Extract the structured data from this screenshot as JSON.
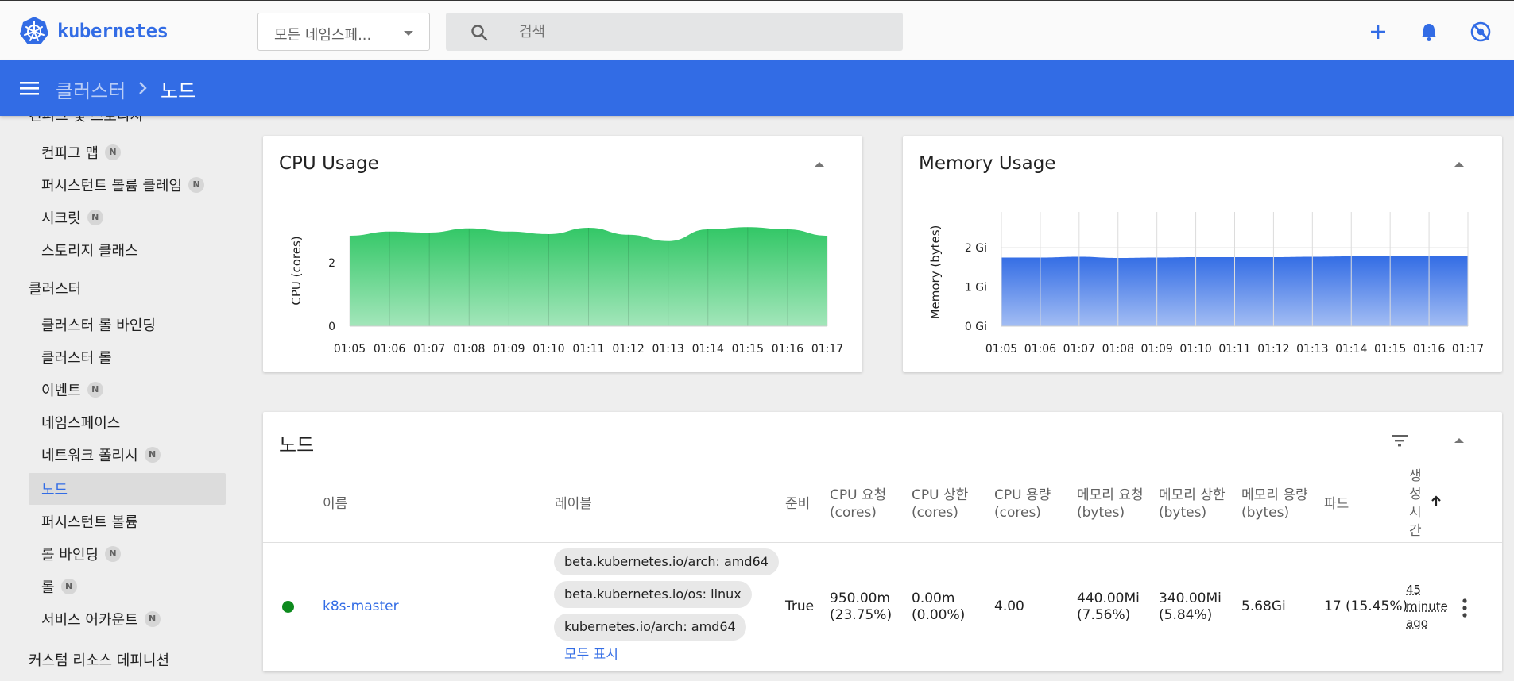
{
  "app": {
    "name": "kubernetes"
  },
  "topbar": {
    "namespace_select": "모든 네임스페...",
    "search_placeholder": "검색",
    "icons": [
      "plus-icon",
      "bell-icon",
      "settings-off-icon"
    ]
  },
  "breadcrumb": {
    "parent": "클러스터",
    "current": "노드"
  },
  "sidebar": {
    "partial_top": "컨피그 및 스토리지",
    "group1_items": [
      {
        "label": "컨피그 맵",
        "badge": "N"
      },
      {
        "label": "퍼시스턴트 볼륨 클레임",
        "badge": "N"
      },
      {
        "label": "시크릿",
        "badge": "N"
      },
      {
        "label": "스토리지 클래스",
        "badge": ""
      }
    ],
    "cluster_header": "클러스터",
    "cluster_items": [
      {
        "label": "클러스터 롤 바인딩",
        "badge": ""
      },
      {
        "label": "클러스터 롤",
        "badge": ""
      },
      {
        "label": "이벤트",
        "badge": "N"
      },
      {
        "label": "네임스페이스",
        "badge": ""
      },
      {
        "label": "네트워크 폴리시",
        "badge": "N"
      },
      {
        "label": "노드",
        "badge": "",
        "active": true
      },
      {
        "label": "퍼시스턴트 볼륨",
        "badge": ""
      },
      {
        "label": "롤 바인딩",
        "badge": "N"
      },
      {
        "label": "롤",
        "badge": "N"
      },
      {
        "label": "서비스 어카운트",
        "badge": "N"
      }
    ],
    "crd_header": "커스텀 리소스 데피니션"
  },
  "chart_data": [
    {
      "type": "area",
      "title": "CPU Usage",
      "ylabel": "CPU (cores)",
      "x": [
        "01:05",
        "01:06",
        "01:07",
        "01:08",
        "01:09",
        "01:10",
        "01:11",
        "01:12",
        "01:13",
        "01:14",
        "01:15",
        "01:16",
        "01:17"
      ],
      "y": [
        2.85,
        2.98,
        2.95,
        3.08,
        2.98,
        2.9,
        3.1,
        2.88,
        2.68,
        3.05,
        3.12,
        3.05,
        2.85
      ],
      "yticks": [
        0,
        2
      ],
      "ylim": [
        0,
        3.5
      ],
      "color": "#32c766",
      "grid": "vertical"
    },
    {
      "type": "area",
      "title": "Memory Usage",
      "ylabel": "Memory (bytes)",
      "x": [
        "01:05",
        "01:06",
        "01:07",
        "01:08",
        "01:09",
        "01:10",
        "01:11",
        "01:12",
        "01:13",
        "01:14",
        "01:15",
        "01:16",
        "01:17"
      ],
      "y": [
        1.75,
        1.75,
        1.77,
        1.74,
        1.75,
        1.76,
        1.76,
        1.76,
        1.77,
        1.78,
        1.8,
        1.79,
        1.78
      ],
      "yticks": [
        0,
        1,
        2
      ],
      "ytick_labels": [
        "0 Gi",
        "1 Gi",
        "2 Gi"
      ],
      "ylim": [
        0,
        2.75
      ],
      "unit": "Gi",
      "color": "#326ce5",
      "grid": "both"
    }
  ],
  "nodes_table": {
    "title": "노드",
    "headers": {
      "name": "이름",
      "labels": "레이블",
      "ready": "준비",
      "cpu_req": [
        "CPU 요청",
        "(cores)"
      ],
      "cpu_lim": [
        "CPU 상한",
        "(cores)"
      ],
      "cpu_cap": [
        "CPU 용량",
        "(cores)"
      ],
      "mem_req": [
        "메모리 요청",
        "(bytes)"
      ],
      "mem_lim": [
        "메모리 상한",
        "(bytes)"
      ],
      "mem_cap": [
        "메모리 용량",
        "(bytes)"
      ],
      "pods": "파드",
      "created": [
        "생",
        "성",
        "시",
        "간"
      ]
    },
    "rows": [
      {
        "status_color": "#0d8a1e",
        "name": "k8s-master",
        "labels": [
          "beta.kubernetes.io/arch: amd64",
          "beta.kubernetes.io/os: linux",
          "kubernetes.io/arch: amd64"
        ],
        "show_all": "모두 표시",
        "ready": "True",
        "cpu_req": [
          "950.00m",
          "(23.75%)"
        ],
        "cpu_lim": [
          "0.00m",
          "(0.00%)"
        ],
        "cpu_cap": "4.00",
        "mem_req": [
          "440.00Mi",
          "(7.56%)"
        ],
        "mem_lim": [
          "340.00Mi",
          "(5.84%)"
        ],
        "mem_cap": "5.68Gi",
        "pods": "17 (15.45%)",
        "created": [
          "45",
          "minute",
          "ago"
        ]
      }
    ]
  }
}
